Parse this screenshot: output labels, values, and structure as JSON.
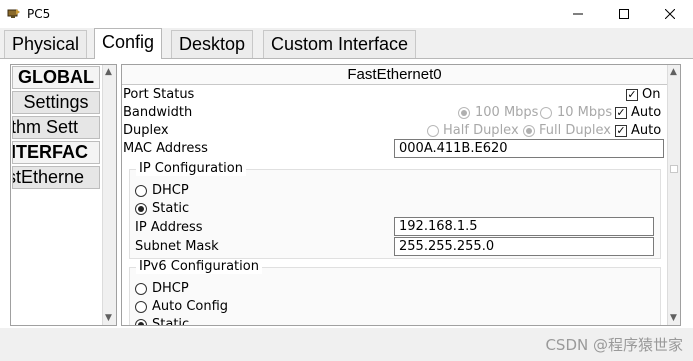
{
  "window": {
    "title": "PC5",
    "min_glyph": "—",
    "max_glyph": "☐",
    "close_glyph": "✕"
  },
  "tabs": [
    "Physical",
    "Config",
    "Desktop",
    "Custom Interface"
  ],
  "active_tab": "Config",
  "left_nav": {
    "items": [
      {
        "label": "GLOBAL",
        "bold": true
      },
      {
        "label": "Settings",
        "bold": false
      },
      {
        "label": "rithm Sett",
        "bold": false
      },
      {
        "label": "NTERFAC",
        "bold": true
      },
      {
        "label": "stEtherne",
        "bold": false
      }
    ]
  },
  "panel": {
    "title": "FastEthernet0",
    "port_status": {
      "label": "Port Status",
      "on_label": "On",
      "checked": true
    },
    "bandwidth": {
      "label": "Bandwidth",
      "option_100": "100 Mbps",
      "option_10": "10 Mbps",
      "auto_label": "Auto",
      "auto_checked": true
    },
    "duplex": {
      "label": "Duplex",
      "half": "Half Duplex",
      "full": "Full Duplex",
      "auto_label": "Auto",
      "auto_checked": true
    },
    "mac": {
      "label": "MAC Address",
      "value": "000A.411B.E620"
    },
    "ipv4": {
      "title": "IP Configuration",
      "dhcp": "DHCP",
      "static": "Static",
      "selected": "Static",
      "ip_label": "IP Address",
      "ip_value": "192.168.1.5",
      "mask_label": "Subnet Mask",
      "mask_value": "255.255.255.0"
    },
    "ipv6": {
      "title": "IPv6 Configuration",
      "dhcp": "DHCP",
      "auto": "Auto Config",
      "static": "Static"
    }
  },
  "watermark": "CSDN @程序猿世家",
  "check_glyph": "✓",
  "icons": {
    "app": "network-pc-icon"
  }
}
